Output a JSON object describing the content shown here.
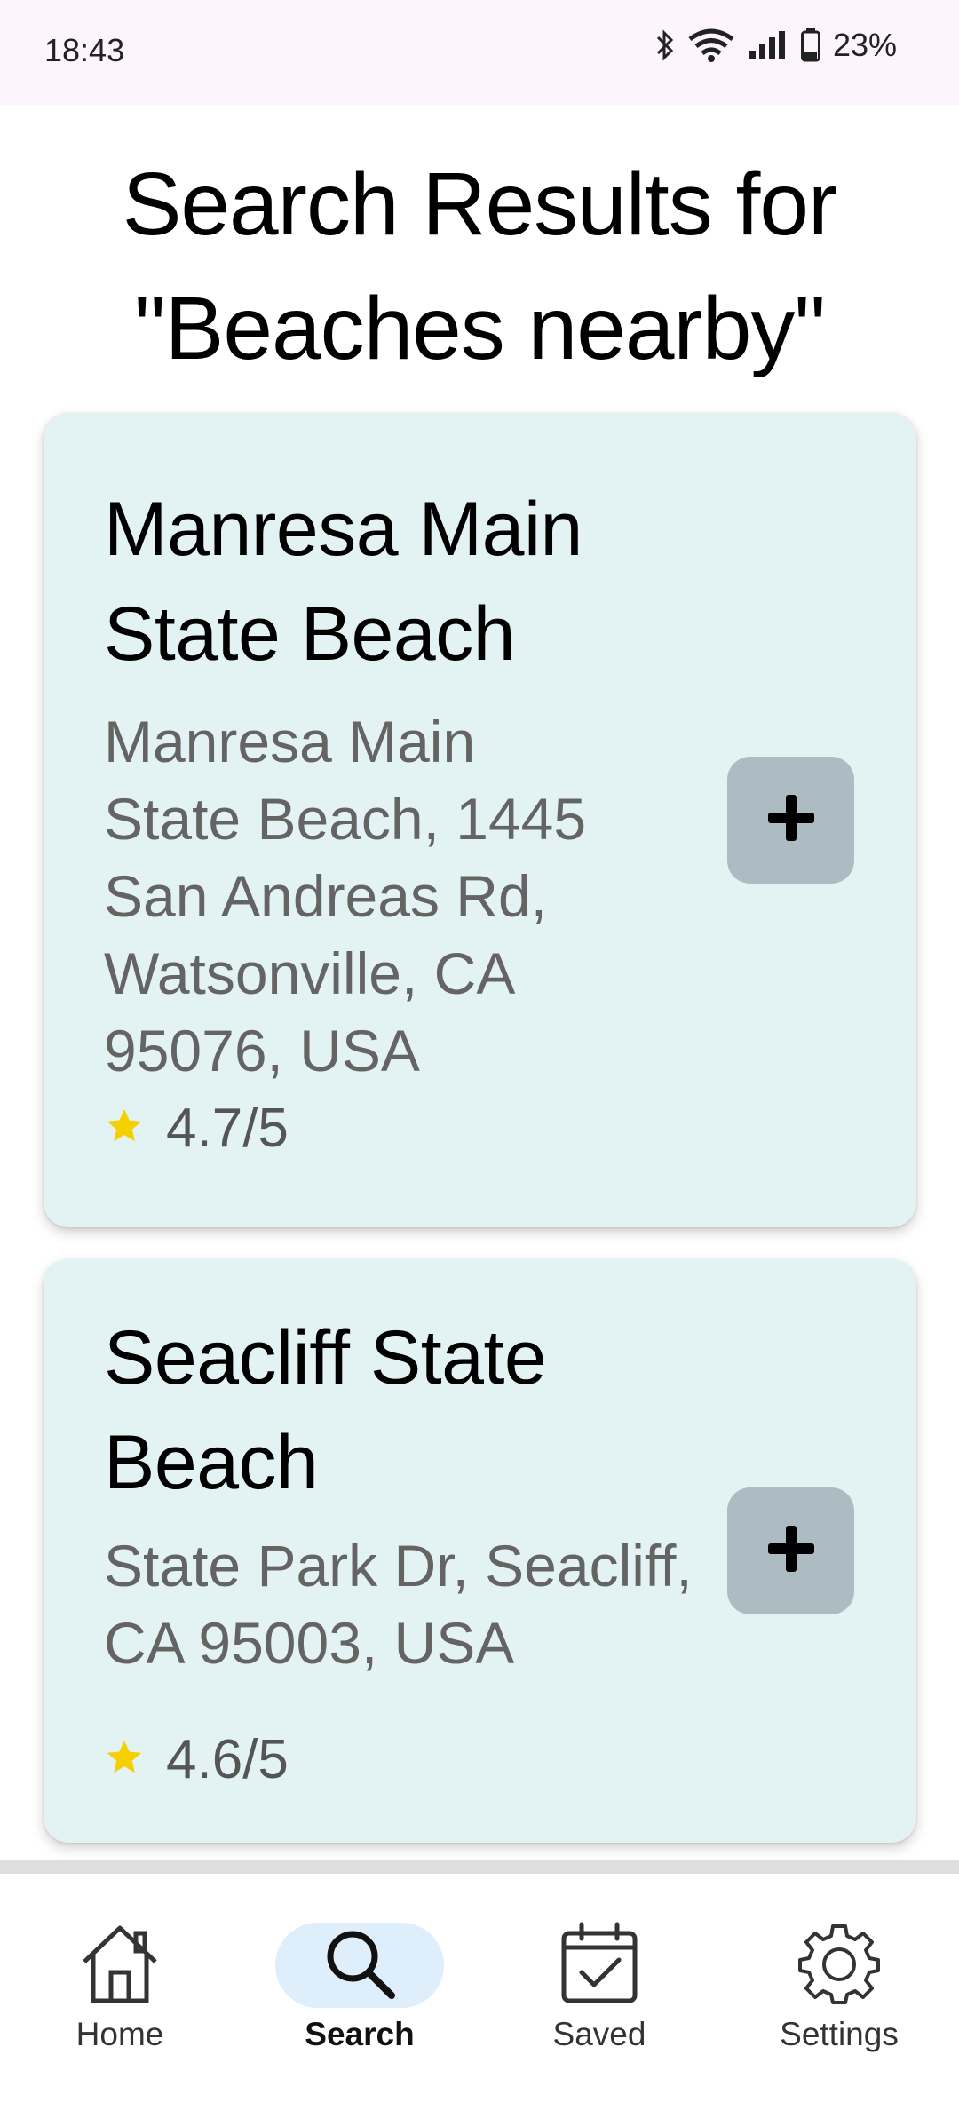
{
  "status_bar": {
    "time": "18:43",
    "battery_text": "23%",
    "icons": [
      "bluetooth-icon",
      "wifi-icon",
      "signal-icon",
      "battery-icon"
    ]
  },
  "page": {
    "title_line1": "Search Results for",
    "title_line2": "\"Beaches nearby\""
  },
  "results": [
    {
      "title_line1": "Manresa Main",
      "title_line2": "State Beach",
      "address_lines": [
        "Manresa Main",
        "State Beach, 1445",
        "San Andreas Rd,",
        "Watsonville, CA",
        "95076, USA"
      ],
      "rating": "4.7/5",
      "add_icon": "plus-icon"
    },
    {
      "title_line1": "Seacliff State",
      "title_line2": "Beach",
      "address_lines": [
        "State Park Dr, Seacliff,",
        "CA 95003, USA"
      ],
      "rating": "4.6/5",
      "add_icon": "plus-icon"
    }
  ],
  "nav": {
    "items": [
      {
        "label": "Home",
        "icon": "home-icon",
        "active": false
      },
      {
        "label": "Search",
        "icon": "search-icon",
        "active": true
      },
      {
        "label": "Saved",
        "icon": "calendar-check-icon",
        "active": false
      },
      {
        "label": "Settings",
        "icon": "gear-icon",
        "active": false
      }
    ]
  },
  "colors": {
    "card_background": "#e3f3f3",
    "add_button": "#adbbc3",
    "star": "#f5d000",
    "active_nav_pill": "#dfeefb",
    "status_bar_background": "#fdf5fb"
  }
}
